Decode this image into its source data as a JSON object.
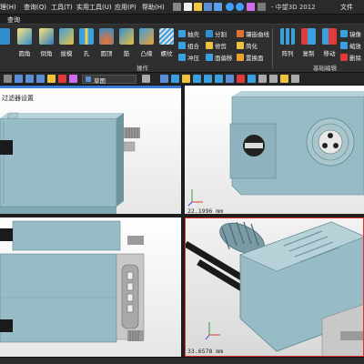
{
  "menubar": {
    "partial_left": "理(H)",
    "menus": [
      "查询(Q)",
      "工具(T)",
      "实用工具(U)",
      "应用(P)",
      "帮助(H)"
    ],
    "app_title": "- 中望3D 2012",
    "file_menu": "文件"
  },
  "tab": {
    "label": "查询"
  },
  "ribbon": {
    "big_buttons": [
      "圆角",
      "倒角",
      "拔模",
      "孔",
      "圆顶",
      "筋",
      "凸缘",
      "螺纹"
    ],
    "group_ops_label": "操作",
    "middle_small": [
      "抽壳",
      "分割",
      "镶嵌曲线",
      "组合",
      "修剪",
      "简化",
      "冲压",
      "面偏移",
      "置换面"
    ],
    "group_base_label": "基础编辑",
    "right_big": [
      "阵列",
      "复制",
      "移动"
    ],
    "right_small": [
      "镜像",
      "缩放",
      "删除"
    ]
  },
  "toolbar2": {
    "view_name": "草图"
  },
  "viewport_tl": {
    "panel_label": "过滤器设置"
  },
  "viewport_tr": {
    "scale": "22.1996 mm"
  },
  "viewport_br": {
    "scale": "33.6578 mm"
  }
}
